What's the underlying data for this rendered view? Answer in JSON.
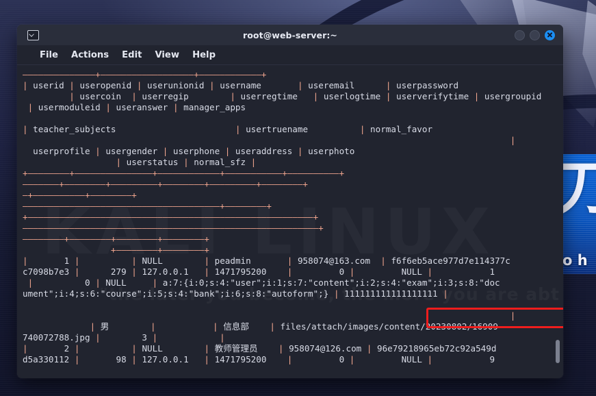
{
  "desktop": {
    "poster_glyph": "刀",
    "poster_text": "to h"
  },
  "window": {
    "title": "root@web-server:~",
    "icon": "terminal-icon",
    "controls": {
      "minimize": "minimize-button",
      "maximize": "maximize-button",
      "close": "close-button"
    }
  },
  "menubar": {
    "items": [
      {
        "label": "File"
      },
      {
        "label": "Actions"
      },
      {
        "label": "Edit"
      },
      {
        "label": "View"
      },
      {
        "label": "Help"
      }
    ]
  },
  "terminal": {
    "watermark": "KALI LINUX",
    "watermark2": "\"the later you become, the more you are abt to he",
    "lines": [
      "——————————————+——————————————————+————————————+",
      "| userid | useropenid | userunionid | username       | useremail      | userpassword",
      "         | usercoin  | userregip        | userregtime   | userlogtime | userverifytime | usergroupid",
      " | usermoduleid | useranswer | manager_apps",
      "",
      "| teacher_subjects                       | usertruename          | normal_favor",
      "                                                                                              |",
      "  userprofile | usergender | userphone | useraddress | userphoto",
      "                  | userstatus | normal_sfz |",
      "+————————+———————————————+————————————+———————————+——————————+",
      "———————+————————+—————————+————————+—————————+————————+",
      "—+——————————+————————+",
      "——————————————————————————————————————+————————+",
      "+———————————————————————————————————————————————————————+",
      "—————————————————————————————————————————————————————————+",
      "————————+————————+————————+————————+",
      "                 +————————+————————+",
      "|       1 |          | NULL        | peadmin       | 958074@163.com  | f6f6eb5ace977d7e114377c",
      "c7098b7e3 |      279 | 127.0.0.1   | 1471795200    |         0 |         NULL |           1",
      " |          0 | NULL     | a:7:{i:0;s:4:\"user\";i:1;s:7:\"content\";i:2;s:4:\"exam\";i:3;s:8:\"doc",
      "ument\";i:4;s:6:\"course\";i:5;s:4:\"bank\";i:6;s:8:\"autoform\";} | 111111111111111111 |",
      "",
      "                                                                                              |",
      "             | 男        |           | 信息部    | files/attach/images/content/20230802/16909",
      "740072788.jpg |        3 |            |",
      "|       2 |          | NULL        | 教师管理员    | 958074@126.com | 96e79218965eb72c92a549d",
      "d5a330112 |       98 | 127.0.0.1   | 1471795200    |         0 |         NULL |           9"
    ],
    "highlight": {
      "name": "password-hash-highlight",
      "value": "f6f6eb5ace977d7e114377c",
      "color": "#ef1d1d"
    },
    "scrollbar": "vertical-scrollbar"
  }
}
